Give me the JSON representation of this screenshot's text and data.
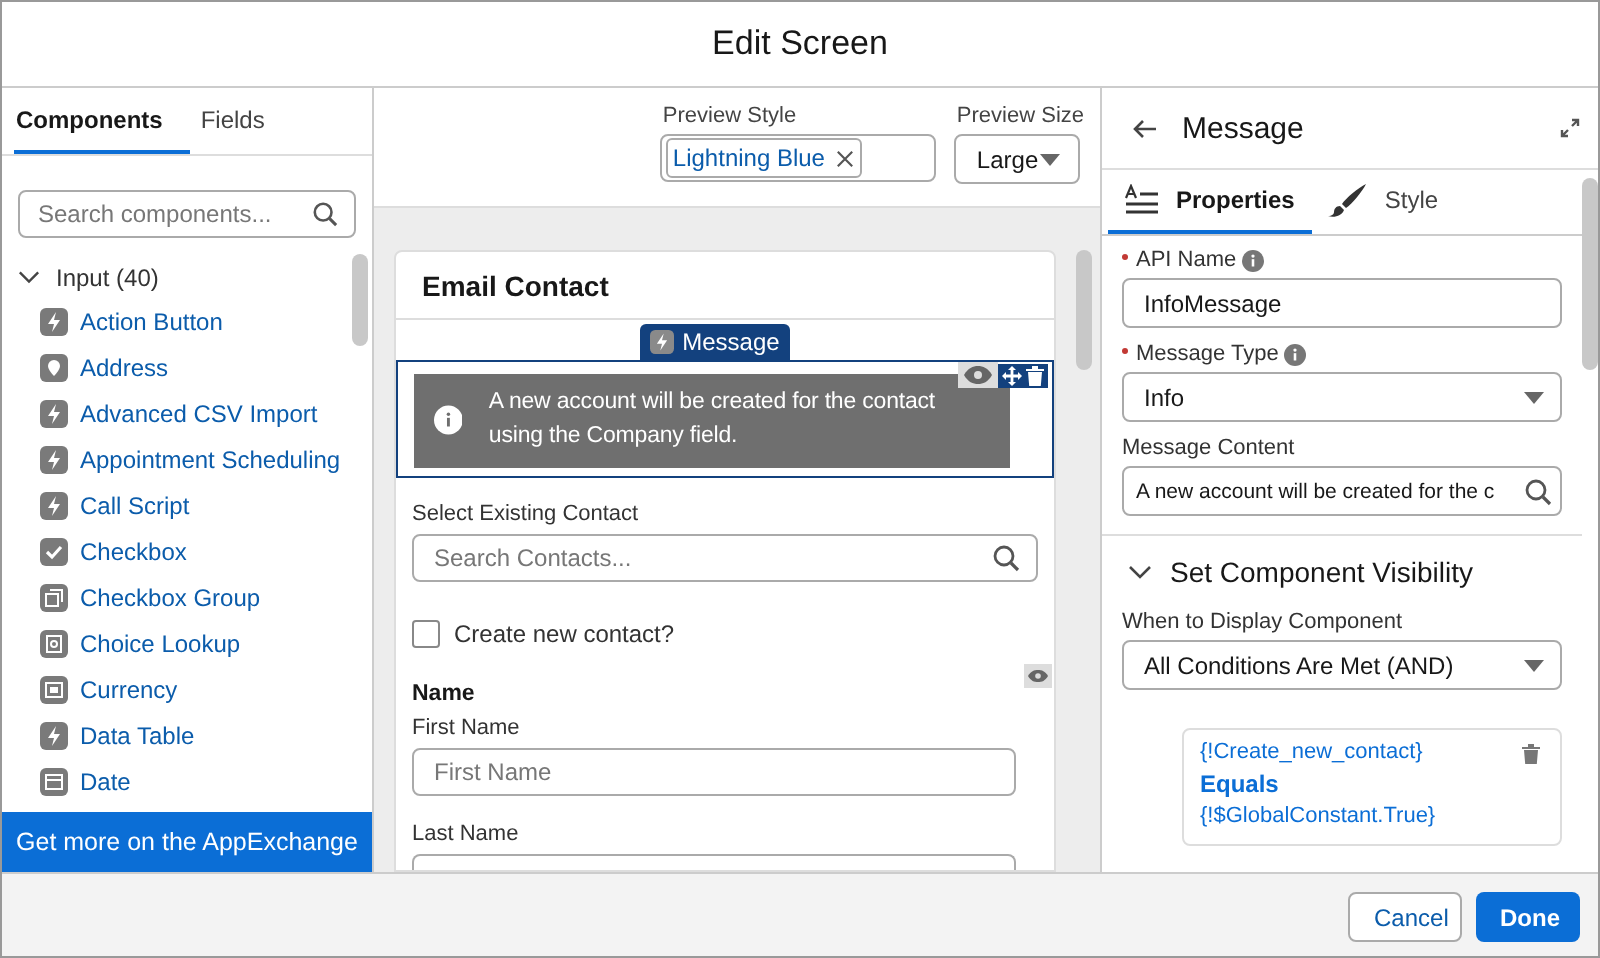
{
  "window": {
    "title": "Edit Screen"
  },
  "left_panel": {
    "tabs": [
      {
        "label": "Components",
        "selected": true
      },
      {
        "label": "Fields",
        "selected": false
      }
    ],
    "search": {
      "placeholder": "Search components..."
    },
    "group": {
      "label": "Input (40)",
      "expanded": true,
      "items": [
        {
          "label": "Action Button",
          "kind": "bolt"
        },
        {
          "label": "Address",
          "kind": "pin"
        },
        {
          "label": "Advanced CSV Import",
          "kind": "bolt"
        },
        {
          "label": "Appointment Scheduling",
          "kind": "bolt"
        },
        {
          "label": "Call Script",
          "kind": "bolt"
        },
        {
          "label": "Checkbox",
          "kind": "check"
        },
        {
          "label": "Checkbox Group",
          "kind": "group"
        },
        {
          "label": "Choice Lookup",
          "kind": "lookup"
        },
        {
          "label": "Currency",
          "kind": "currency"
        },
        {
          "label": "Data Table",
          "kind": "bolt"
        },
        {
          "label": "Date",
          "kind": "date"
        }
      ]
    },
    "appexchange_button": "Get more on the AppExchange"
  },
  "preview": {
    "style_label": "Preview Style",
    "style_value": "Lightning Blue",
    "size_label": "Preview Size",
    "size_value": "Large"
  },
  "screen": {
    "title": "Email Contact",
    "message": {
      "tag": "Message",
      "text": "A new account will be created for the contact using the Company field.",
      "selected": true
    },
    "contact_search": {
      "label": "Select Existing Contact",
      "placeholder": "Search Contacts..."
    },
    "checkbox": {
      "label": "Create new contact?",
      "checked": false
    },
    "name_section": {
      "title": "Name",
      "first_name": {
        "label": "First Name",
        "placeholder": "First Name"
      },
      "last_name": {
        "label": "Last Name"
      }
    }
  },
  "properties": {
    "title": "Message",
    "tabs": [
      {
        "label": "Properties",
        "selected": true
      },
      {
        "label": "Style",
        "selected": false
      }
    ],
    "fields": [
      {
        "kind": "input",
        "label": "API Name",
        "required": true,
        "info": true,
        "value": "InfoMessage"
      },
      {
        "kind": "select",
        "label": "Message Type",
        "required": true,
        "info": true,
        "value": "Info"
      },
      {
        "kind": "search",
        "label": "Message Content",
        "required": false,
        "info": false,
        "value": "A new account will be created for the c"
      }
    ],
    "visibility": {
      "title": "Set Component Visibility",
      "expanded": true,
      "label": "When to Display Component",
      "value": "All Conditions Are Met (AND)",
      "condition": {
        "resource": "{!Create_new_contact}",
        "operator": "Equals",
        "value": "{!$GlobalConstant.True}"
      }
    }
  },
  "footer": {
    "buttons": [
      {
        "label": "Cancel",
        "kind": "neutral"
      },
      {
        "label": "Done",
        "kind": "brand"
      }
    ]
  }
}
